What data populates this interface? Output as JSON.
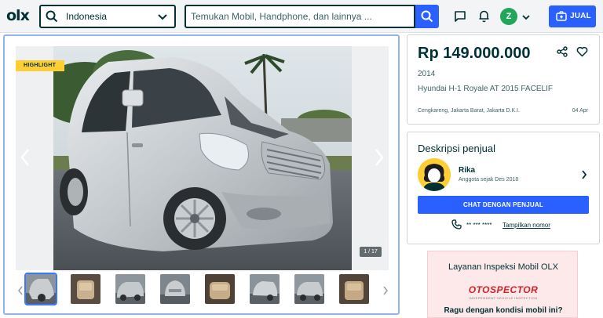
{
  "header": {
    "logo": "olx",
    "location_value": "Indonesia",
    "search_placeholder": "Temukan Mobil, Handphone, dan lainnya ...",
    "avatar_initial": "Z",
    "sell_label": "JUAL"
  },
  "gallery": {
    "badge": "HIGHLIGHT",
    "counter": "1 / 17",
    "thumbnails": 8
  },
  "listing": {
    "price": "Rp 149.000.000",
    "year": "2014",
    "title": "Hyundai H-1 Royale AT 2015 FACELIF",
    "location": "Cengkareng, Jakarta Barat, Jakarta D.K.I.",
    "date": "04 Apr"
  },
  "seller": {
    "section_title": "Deskripsi penjual",
    "name": "Rika",
    "member_since": "Anggota sejak Des 2018",
    "chat_label": "CHAT DENGAN PENJUAL",
    "phone_masked": "** *** ****",
    "phone_link": "Tampilkan nomor"
  },
  "inspection": {
    "title": "Layanan Inspeksi Mobil OLX",
    "brand": "OTOSPECTOR",
    "tagline": "INDEPENDENT VEHICLE INSPECTION",
    "question": "Ragu dengan kondisi mobil ini?"
  },
  "colors": {
    "accent": "#2a60ff",
    "text": "#002f34",
    "highlight": "#ffce32",
    "brand_red": "#d42027"
  }
}
